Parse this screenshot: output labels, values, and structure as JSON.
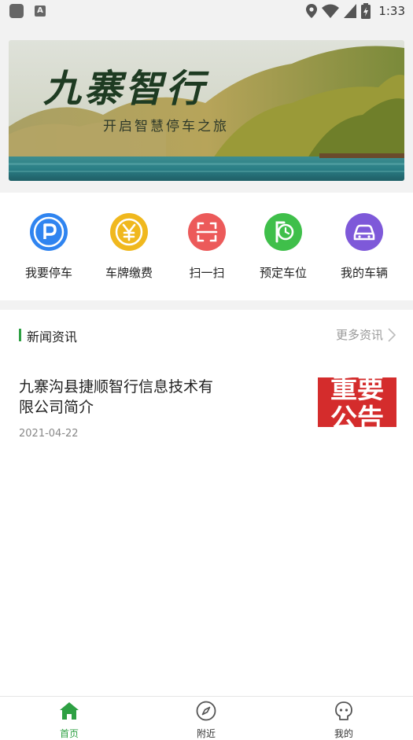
{
  "status_bar": {
    "time": "1:33",
    "a_badge": "A",
    "icons": [
      "app-icon",
      "keyboard-a-icon",
      "location-icon",
      "wifi-icon",
      "signal-icon",
      "battery-icon"
    ]
  },
  "banner": {
    "title": "九寨智行",
    "subtitle": "开启智慧停车之旅"
  },
  "quick_actions": [
    {
      "label": "我要停车",
      "icon": "parking-p-icon",
      "color": "#2f84f0"
    },
    {
      "label": "车牌缴费",
      "icon": "yen-icon",
      "color": "#f0b81e"
    },
    {
      "label": "扫一扫",
      "icon": "scan-icon",
      "color": "#ec5a5a"
    },
    {
      "label": "预定车位",
      "icon": "reserve-clock-icon",
      "color": "#3fbf4a"
    },
    {
      "label": "我的车辆",
      "icon": "car-icon",
      "color": "#7e59d9"
    }
  ],
  "news": {
    "section_title": "新闻资讯",
    "more_label": "更多资讯",
    "items": [
      {
        "title": "九寨沟县捷顺智行信息技术有限公司简介",
        "date": "2021-04-22",
        "thumb_text": "重要公告"
      }
    ]
  },
  "bottom_nav": [
    {
      "label": "首页",
      "icon": "home-icon",
      "active": true
    },
    {
      "label": "附近",
      "icon": "compass-icon",
      "active": false
    },
    {
      "label": "我的",
      "icon": "profile-icon",
      "active": false
    }
  ],
  "colors": {
    "accent": "#2ea043",
    "divider": "#f2f2f2"
  }
}
